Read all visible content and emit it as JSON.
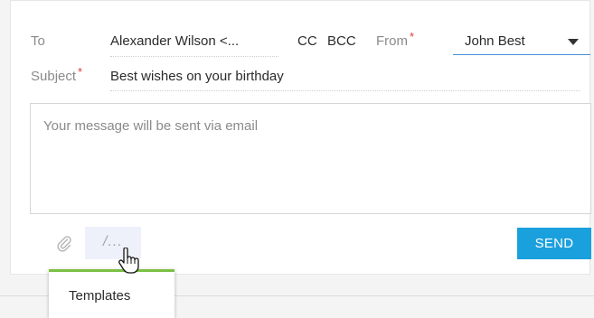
{
  "to": {
    "label": "To",
    "value": "Alexander Wilson <..."
  },
  "cc_label": "CC",
  "bcc_label": "BCC",
  "from": {
    "label": "From",
    "required_mark": "*",
    "value": "John Best"
  },
  "subject": {
    "label": "Subject",
    "required_mark": "*",
    "value": "Best wishes on your birthday"
  },
  "message": {
    "placeholder": "Your message will be sent via email"
  },
  "toolbar": {
    "templates_glyph": "/...",
    "send_label": "SEND"
  },
  "tooltip": {
    "text": "Templates"
  },
  "colors": {
    "send_button": "#1aa0dd",
    "required": "#e53935",
    "tooltip_accent": "#7bc043",
    "from_underline": "#4a90d9"
  },
  "icons": {
    "attach": "paperclip-icon",
    "cursor": "hand-pointer-cursor"
  }
}
